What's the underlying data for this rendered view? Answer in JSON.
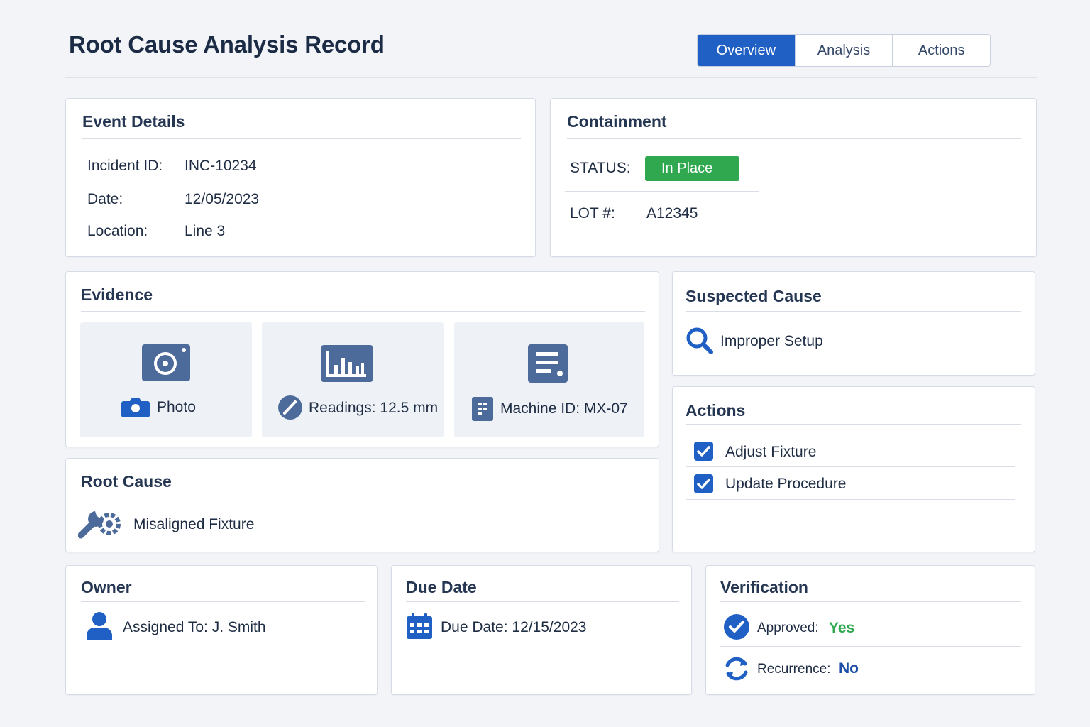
{
  "page_title": "Root Cause Analysis Record",
  "tabs": [
    {
      "label": "Overview",
      "active": true
    },
    {
      "label": "Analysis",
      "active": false
    },
    {
      "label": "Actions",
      "active": false
    }
  ],
  "event_details": {
    "title": "Event Details",
    "incident_label": "Incident ID:",
    "incident_value": "INC-10234",
    "date_label": "Date:",
    "date_value": "12/05/2023",
    "location_label": "Location:",
    "location_value": "Line 3"
  },
  "containment": {
    "title": "Containment",
    "status_label": "STATUS:",
    "status_value": "In Place",
    "lot_label": "LOT #:",
    "lot_value": "A12345"
  },
  "evidence": {
    "title": "Evidence",
    "items": [
      {
        "icon": "camera-icon",
        "label": "Photo"
      },
      {
        "icon": "gauge-icon",
        "label": "Readings: 12.5 mm"
      },
      {
        "icon": "machine-icon",
        "label": "Machine ID: MX-07"
      }
    ]
  },
  "suspected_cause": {
    "title": "Suspected Cause",
    "icon": "search-icon",
    "value": "Improper Setup"
  },
  "root_cause": {
    "title": "Root Cause",
    "icon": "wrench-gear-icon",
    "value": "Misaligned Fixture"
  },
  "actions": {
    "title": "Actions",
    "items": [
      {
        "label": "Adjust Fixture",
        "checked": true
      },
      {
        "label": "Update Procedure",
        "checked": true
      }
    ]
  },
  "owner": {
    "title": "Owner",
    "icon": "user-icon",
    "assigned": "Assigned To: J. Smith"
  },
  "due_date": {
    "title": "Due Date",
    "icon": "calendar-icon",
    "value": "Due Date: 12/15/2023"
  },
  "verification": {
    "title": "Verification",
    "approved_label": "Approved:",
    "approved_value": "Yes",
    "recurrence_label": "Recurrence:",
    "recurrence_value": "No"
  },
  "colors": {
    "accent": "#2060c4",
    "icon": "#4d6b9a",
    "success": "#2fa84f",
    "background": "#f2f4f8"
  }
}
